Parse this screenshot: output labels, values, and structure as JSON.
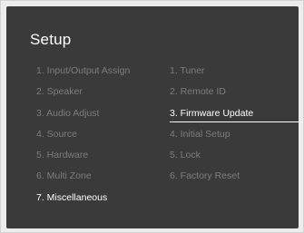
{
  "screen": {
    "title": "Setup"
  },
  "menu": {
    "left": [
      {
        "label": "1. Input/Output Assign"
      },
      {
        "label": "2. Speaker"
      },
      {
        "label": "3. Audio Adjust"
      },
      {
        "label": "4. Source"
      },
      {
        "label": "5. Hardware"
      },
      {
        "label": "6. Multi Zone"
      },
      {
        "label": "7. Miscellaneous"
      }
    ],
    "right": [
      {
        "label": "1. Tuner"
      },
      {
        "label": "2. Remote ID"
      },
      {
        "label": "3. Firmware Update"
      },
      {
        "label": "4. Initial Setup"
      },
      {
        "label": "5. Lock"
      },
      {
        "label": "6. Factory Reset"
      }
    ],
    "active_category": "7. Miscellaneous",
    "selected_item": "3. Firmware Update"
  },
  "colors": {
    "screen_background": "#3a3a3a",
    "active_text": "#ffffff",
    "inactive_text": "#7d7d7d",
    "frame_background": "#ececec"
  }
}
